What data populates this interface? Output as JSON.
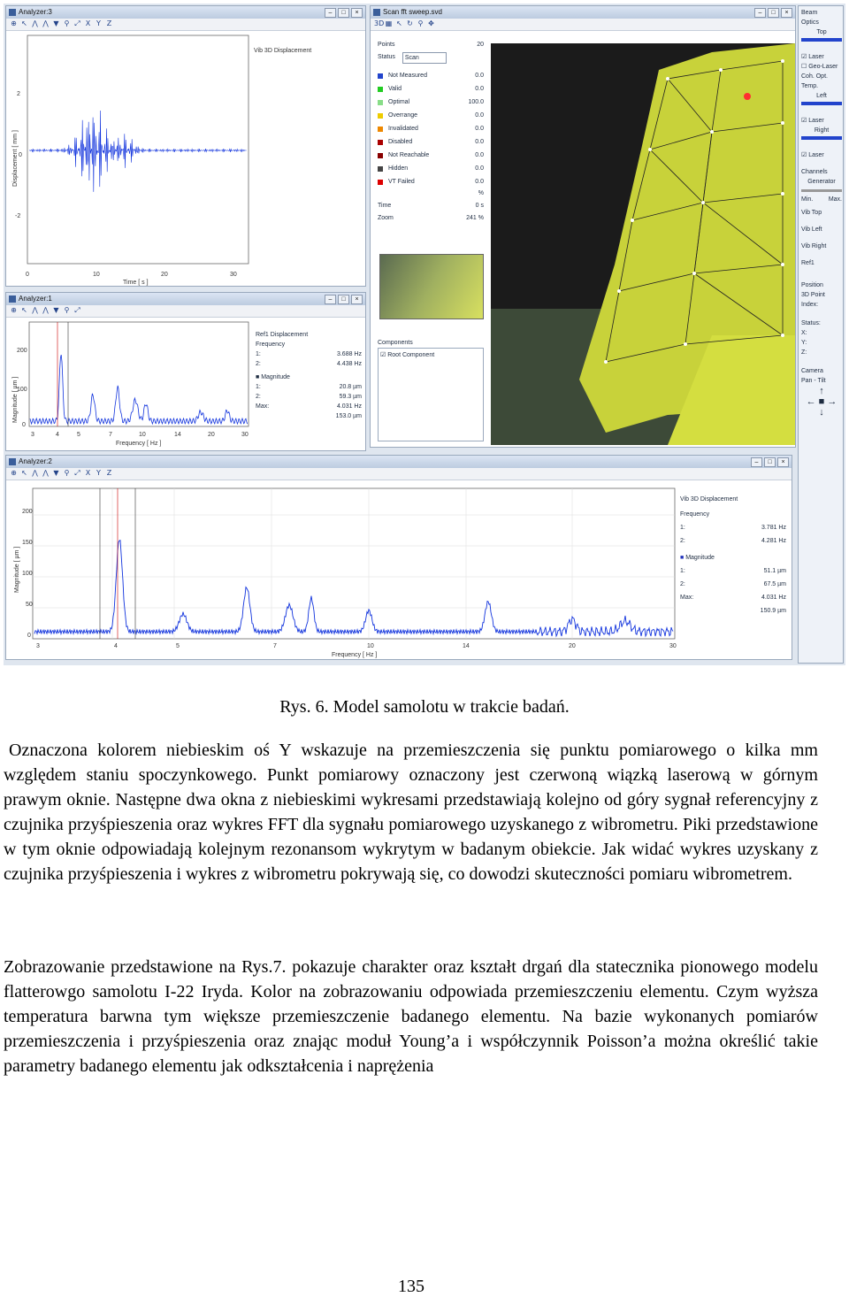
{
  "figure": {
    "analyzer3": {
      "title": "Analyzer:3",
      "panel_title": "Vib 3D Displacement",
      "ylabel": "Displacement [ mm ]",
      "xlabel": "Time [ s ]",
      "yticks": [
        "2",
        "0",
        "-2"
      ],
      "xticks": [
        "0",
        "10",
        "20",
        "30"
      ]
    },
    "analyzer1": {
      "title": "Analyzer:1",
      "ylabel": "Magnitude [ µm ]",
      "xlabel": "Frequency [ Hz ]",
      "yticks": [
        "200",
        "100",
        "0"
      ],
      "xticks": [
        "3",
        "4",
        "5",
        "7",
        "10",
        "14",
        "20",
        "30"
      ],
      "panel": {
        "heading": "Ref1 Displacement",
        "freq_label": "Frequency",
        "f1_label": "1:",
        "f1": "3.688 Hz",
        "f2_label": "2:",
        "f2": "4.438 Hz",
        "mag_label": "Magnitude",
        "m1_label": "1:",
        "m1": "20.8 µm",
        "m2_label": "2:",
        "m2": "59.3 µm",
        "max_label": "Max:",
        "max_f": "4.031 Hz",
        "max_m": "153.0 µm"
      }
    },
    "analyzer2": {
      "title": "Analyzer:2",
      "ylabel": "Magnitude [ µm ]",
      "xlabel": "Frequency [ Hz ]",
      "yticks": [
        "200",
        "150",
        "100",
        "50",
        "0"
      ],
      "xticks": [
        "3",
        "4",
        "5",
        "7",
        "10",
        "14",
        "20",
        "30"
      ],
      "panel": {
        "heading": "Vib 3D Displacement",
        "freq_label": "Frequency",
        "f1_label": "1:",
        "f1": "3.781 Hz",
        "f2_label": "2:",
        "f2": "4.281 Hz",
        "mag_label": "Magnitude",
        "m1_label": "1:",
        "m1": "51.1 µm",
        "m2_label": "2:",
        "m2": "67.5 µm",
        "max_label": "Max:",
        "max_f": "4.031 Hz",
        "max_m": "150.9 µm"
      }
    },
    "scan": {
      "title": "Scan fft sweep.svd",
      "points_label": "Points",
      "points": "20",
      "status_label": "Status",
      "status_value": "Scan",
      "statuses": [
        {
          "name": "Not Measured",
          "value": "0.0",
          "color": "#2244cc"
        },
        {
          "name": "Valid",
          "value": "0.0",
          "color": "#22cc22"
        },
        {
          "name": "Optimal",
          "value": "100.0",
          "color": "#88dd88"
        },
        {
          "name": "Overrange",
          "value": "0.0",
          "color": "#eecc00"
        },
        {
          "name": "Invalidated",
          "value": "0.0",
          "color": "#ee8800"
        },
        {
          "name": "Disabled",
          "value": "0.0",
          "color": "#aa0000"
        },
        {
          "name": "Not Reachable",
          "value": "0.0",
          "color": "#880000"
        },
        {
          "name": "Hidden",
          "value": "0.0",
          "color": "#444444"
        },
        {
          "name": "VT Failed",
          "value": "0.0",
          "color": "#dd0000"
        }
      ],
      "percent": "%",
      "time_label": "Time",
      "time": "0 s",
      "zoom_label": "Zoom",
      "zoom": "241 %",
      "components_label": "Components",
      "root_component": "Root Component"
    },
    "right_panel": {
      "beam": "Beam",
      "optics": "Optics",
      "top": "Top",
      "laser": "Laser",
      "geo_laser": "Geo-Laser",
      "coh_opt": "Coh. Opt.",
      "temp": "Temp.",
      "left": "Left",
      "laser2": "Laser",
      "right": "Right",
      "laser3": "Laser",
      "channels": "Channels",
      "generator": "Generator",
      "min": "Min.",
      "max": "Max.",
      "vib_top": "Vib Top",
      "vib_left": "Vib Left",
      "vib_right": "Vib Right",
      "ref1": "Ref1",
      "position": "Position",
      "point_3d": "3D Point",
      "index": "Index:",
      "status": "Status:",
      "x": "X:",
      "y": "Y:",
      "z": "Z:",
      "camera": "Camera",
      "pan_tilt": "Pan - Tilt"
    }
  },
  "caption": "Rys. 6. Model samolotu w trakcie badań.",
  "paragraph1": "Oznaczona kolorem niebieskim oś Y wskazuje na przemieszczenia się punktu pomiarowego o kilka mm względem staniu spoczynkowego. Punkt pomiarowy oznaczony jest czerwoną wiązką laserową w górnym prawym oknie. Następne dwa okna z niebieskimi wykresami przedstawiają kolejno od góry sygnał referencyjny z czujnika przyśpieszenia oraz wykres FFT dla sygnału pomiarowego uzyskanego z wibrometru. Piki przedstawione w tym oknie odpowiadają kolejnym rezonansom wykrytym w badanym obiekcie. Jak widać wykres uzyskany z czujnika przyśpieszenia i wykres z wibrometru pokrywają się, co dowodzi skuteczności pomiaru wibrometrem.",
  "paragraph2": "Zobrazowanie przedstawione na Rys.7. pokazuje charakter oraz kształt drgań dla statecznika pionowego modelu flatterowgo samolotu I-22 Iryda. Kolor na zobrazowaniu odpowiada przemieszczeniu elementu. Czym wyższa temperatura barwna tym większe przemieszczenie badanego elementu. Na bazie wykonanych pomiarów przemieszczenia i przyśpieszenia oraz znając moduł Young’a i współczynnik Poisson’a można określić takie parametry badanego elementu jak odkształcenia i naprężenia",
  "page_number": "135"
}
